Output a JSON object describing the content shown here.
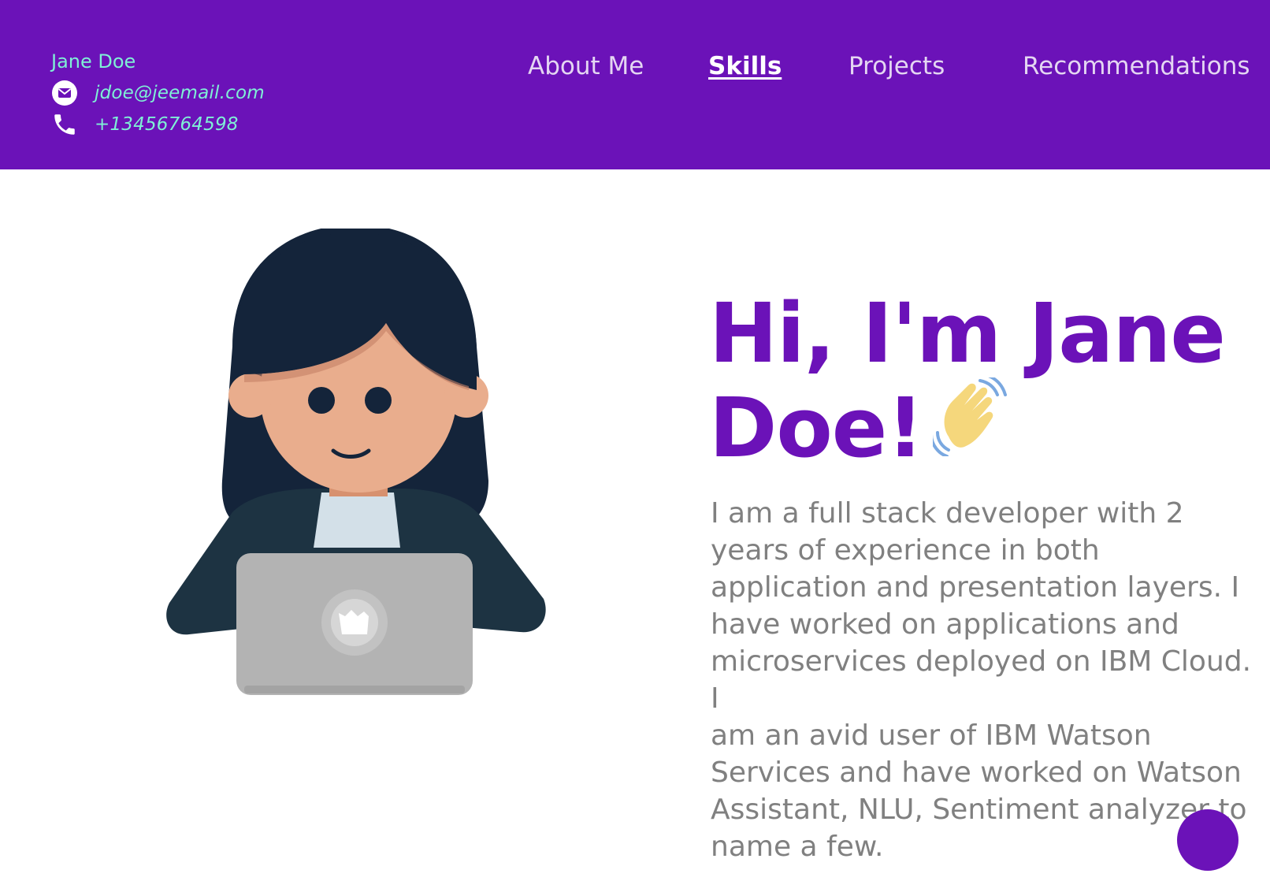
{
  "header": {
    "name": "Jane Doe",
    "email": "jdoe@jeemail.com",
    "phone": "+13456764598",
    "icons": {
      "email": "mail-icon",
      "phone": "phone-icon"
    }
  },
  "nav": {
    "items": [
      {
        "label": "About Me",
        "active": false
      },
      {
        "label": "Skills",
        "active": true
      },
      {
        "label": "Projects",
        "active": false
      },
      {
        "label": "Recommendations",
        "active": false
      }
    ]
  },
  "hero": {
    "title": "Hi, I'm Jane Doe!",
    "emoji": "waving-hand-icon",
    "description_lines": [
      "I am a full stack developer with 2",
      "years of experience in both",
      "application and presentation layers. I",
      "have worked on applications and",
      "microservices deployed on IBM Cloud. I",
      "am an avid user of IBM Watson",
      "Services and have worked on Watson",
      "Assistant, NLU, Sentiment analyzer to",
      "name a few."
    ]
  },
  "colors": {
    "brand": "#6b12b8",
    "contact_text": "#7ff0d6",
    "body_text": "#808080"
  }
}
